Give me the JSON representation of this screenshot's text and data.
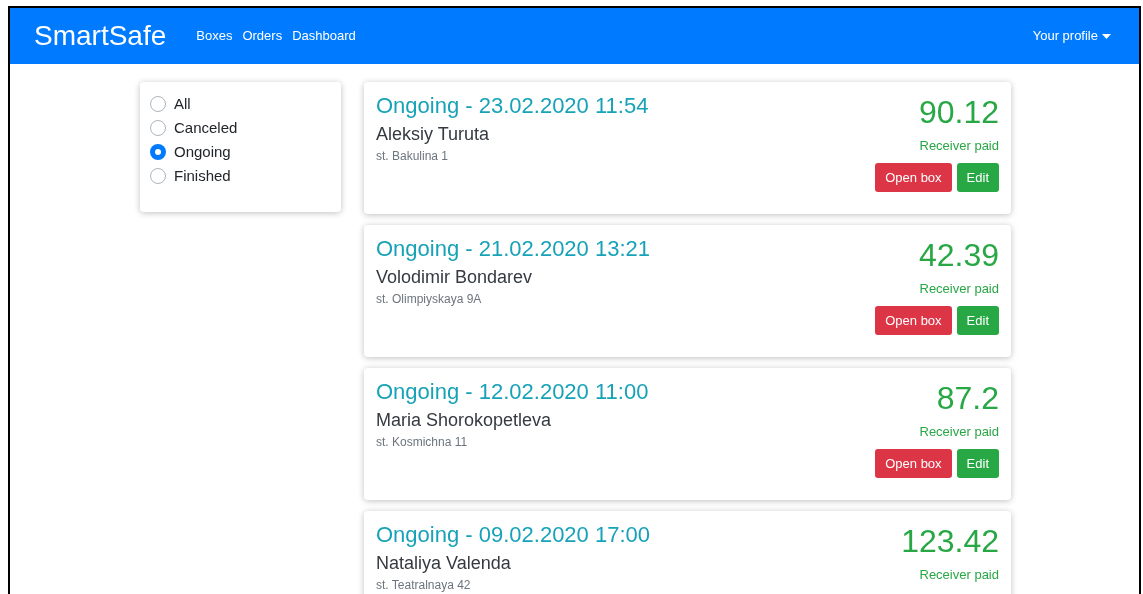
{
  "navbar": {
    "brand": "SmartSafe",
    "links": [
      "Boxes",
      "Orders",
      "Dashboard"
    ],
    "profile": "Your profile"
  },
  "filters": [
    {
      "label": "All",
      "selected": false
    },
    {
      "label": "Canceled",
      "selected": false
    },
    {
      "label": "Ongoing",
      "selected": true
    },
    {
      "label": "Finished",
      "selected": false
    }
  ],
  "orders": [
    {
      "title": "Ongoing - 23.02.2020 11:54",
      "name": "Aleksiy Turuta",
      "address": "st. Bakulina 1",
      "amount": "90.12",
      "payment": "Receiver paid",
      "buttons": [
        {
          "label": "Open box",
          "kind": "danger"
        },
        {
          "label": "Edit",
          "kind": "success"
        }
      ]
    },
    {
      "title": "Ongoing - 21.02.2020 13:21",
      "name": "Volodimir Bondarev",
      "address": "st. Olimpiyskaya 9A",
      "amount": "42.39",
      "payment": "Receiver paid",
      "buttons": [
        {
          "label": "Open box",
          "kind": "danger"
        },
        {
          "label": "Edit",
          "kind": "success"
        }
      ]
    },
    {
      "title": "Ongoing - 12.02.2020 11:00",
      "name": "Maria Shorokopetleva",
      "address": "st. Kosmichna 11",
      "amount": "87.2",
      "payment": "Receiver paid",
      "buttons": [
        {
          "label": "Open box",
          "kind": "danger"
        },
        {
          "label": "Edit",
          "kind": "success"
        }
      ]
    },
    {
      "title": "Ongoing - 09.02.2020 17:00",
      "name": "Nataliya Valenda",
      "address": "st. Teatralnaya 42",
      "amount": "123.42",
      "payment": "Receiver paid"
    }
  ]
}
